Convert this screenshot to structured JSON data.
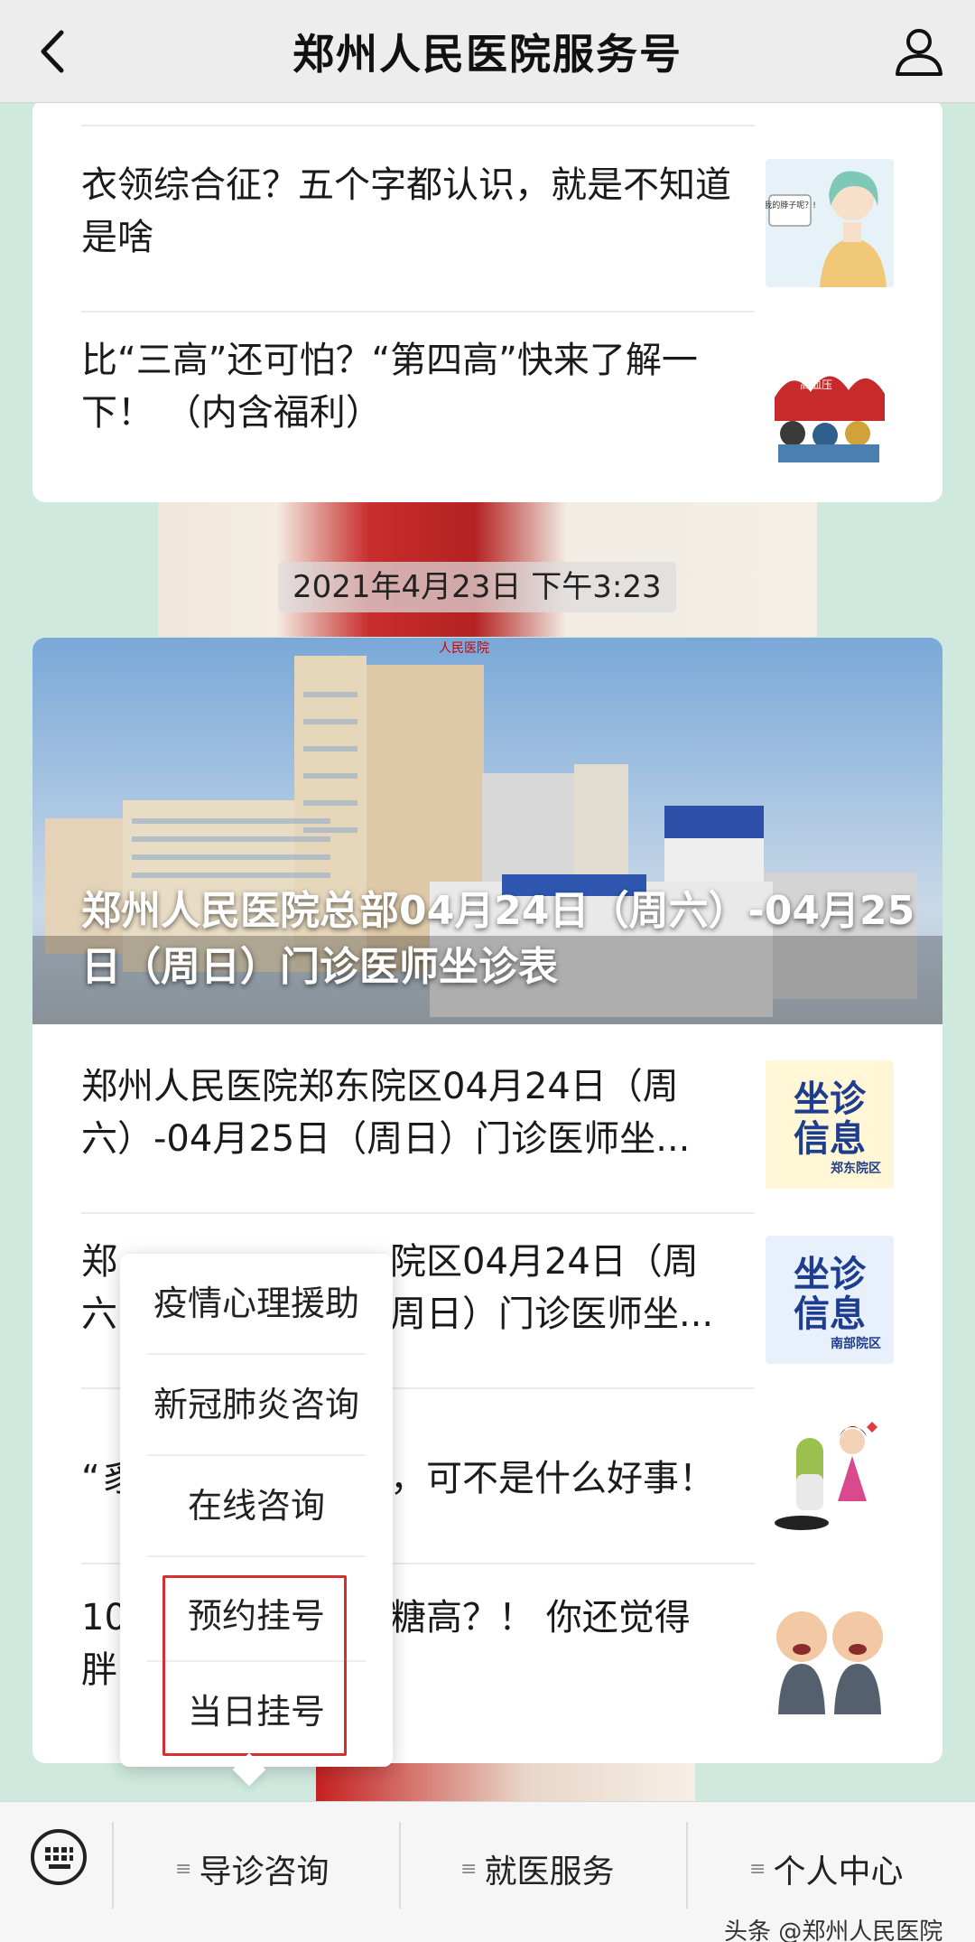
{
  "header": {
    "title": "郑州人民医院服务号"
  },
  "card1": {
    "items": [
      {
        "title": "衣领综合征？五个字都认识，就是不知道是啥",
        "thumb_text": "我的脖子呢？!"
      },
      {
        "title": "比“三高”还可怕？“第四高”快来了解一下！ （内含福利）",
        "thumb_text": "高血压"
      }
    ]
  },
  "timestamp": "2021年4月23日 下午3:23",
  "card2": {
    "hero": {
      "caption": "郑州人民医院总部04月24日（周六）-04月25日（周日）门诊医师坐诊表",
      "sign": "人民医院"
    },
    "items": [
      {
        "title": "郑州人民医院郑东院区04月24日（周六）-04月25日（周日）门诊医师坐...",
        "thumb_line1": "坐诊",
        "thumb_line2": "信息",
        "thumb_tag": "郑东院区"
      },
      {
        "title_prefix": "郑",
        "title_suffix": "院区04月24日（周",
        "title_line2_prefix": "六",
        "title_line2_suffix": "周日）门诊医师坐...",
        "thumb_line1": "坐诊",
        "thumb_line2": "信息",
        "thumb_tag": "南部院区"
      },
      {
        "title_prefix": "“豸",
        "title_suffix": "，可不是什么好事！"
      },
      {
        "title_prefix": "10",
        "title_suffix": "糖高？！ 你还觉得",
        "title_line2_prefix": "胖"
      }
    ]
  },
  "popup_menu": {
    "items": [
      "疫情心理援助",
      "新冠肺炎咨询",
      "在线咨询",
      "预约挂号",
      "当日挂号"
    ]
  },
  "bottom_menu": {
    "items": [
      "导诊咨询",
      "就医服务",
      "个人中心"
    ]
  },
  "watermark": "头条 @郑州人民医院",
  "colors": {
    "highlight": "#d62f2f",
    "background": "#cfe9df",
    "header": "#ededed"
  }
}
